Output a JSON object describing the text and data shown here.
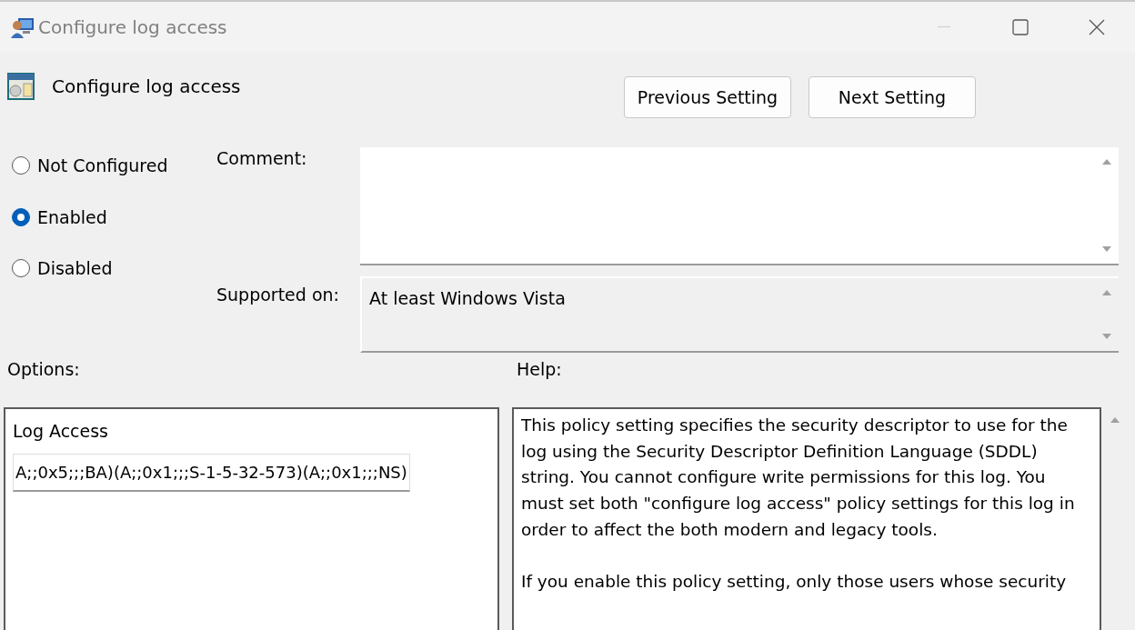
{
  "window": {
    "title": "Configure log access"
  },
  "header": {
    "title": "Configure log access"
  },
  "nav_buttons": [
    {
      "label": "Previous Setting"
    },
    {
      "label": "Next Setting"
    }
  ],
  "state_options": [
    {
      "label": "Not Configured",
      "selected": false
    },
    {
      "label": "Enabled",
      "selected": true
    },
    {
      "label": "Disabled",
      "selected": false
    }
  ],
  "comment": {
    "label": "Comment:"
  },
  "supported_on": {
    "label": "Supported on:",
    "value": "At least Windows Vista"
  },
  "options": {
    "label": "Options:",
    "field_label": "Log Access",
    "value": "A;;0x5;;;BA)(A;;0x1;;;S-1-5-32-573)(A;;0x1;;;NS)"
  },
  "help": {
    "label": "Help:",
    "paragraphs": [
      "This policy setting specifies the security descriptor to use for the log using the Security Descriptor Definition Language (SDDL) string. You cannot configure write permissions for this log. You must set both \"configure log access\" policy settings for this log in order to affect the both modern and legacy tools.",
      "If you enable this policy setting, only those users whose security"
    ]
  }
}
